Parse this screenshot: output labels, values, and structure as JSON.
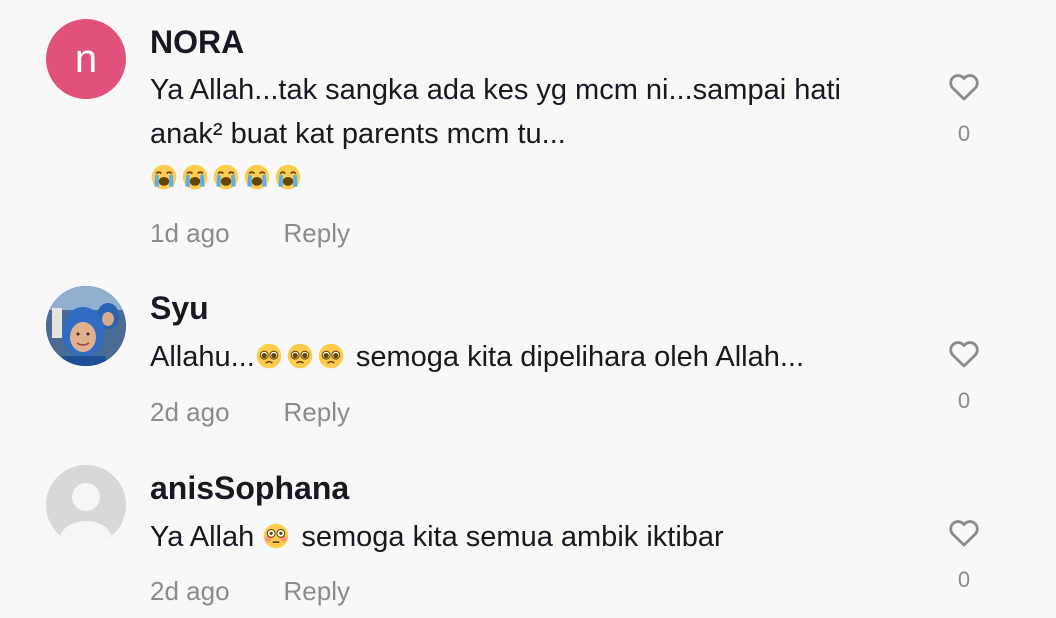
{
  "comments": [
    {
      "avatar_initial": "n",
      "username": "NORA",
      "line1": "Ya Allah...tak sangka ada kes yg mcm ni...sampai hati",
      "line2": "anak² buat kat parents mcm tu...",
      "emoji_line": "😭😭😭😭😭",
      "time": "1d ago",
      "reply_label": "Reply",
      "like_count": "0"
    },
    {
      "username": "Syu",
      "text_before": "Allahu...",
      "emojis": "🥺🥺🥺",
      "text_after": " semoga kita dipelihara oleh Allah...",
      "time": "2d ago",
      "reply_label": "Reply",
      "like_count": "0"
    },
    {
      "username": "anisSophana",
      "text_before": "Ya Allah ",
      "emojis": "😳",
      "text_after": " semoga kita semua ambik iktibar",
      "time": "2d ago",
      "reply_label": "Reply",
      "like_count": "0"
    }
  ],
  "icons": {
    "like": "heart-outline-icon",
    "crying": "loudly-crying-face-icon",
    "pleading": "pleading-face-icon",
    "flushed": "flushed-face-icon"
  },
  "colors": {
    "background": "#f8f8f8",
    "avatar_nora": "#e0527a",
    "text_primary": "#161823",
    "text_secondary": "#8a8b91"
  }
}
